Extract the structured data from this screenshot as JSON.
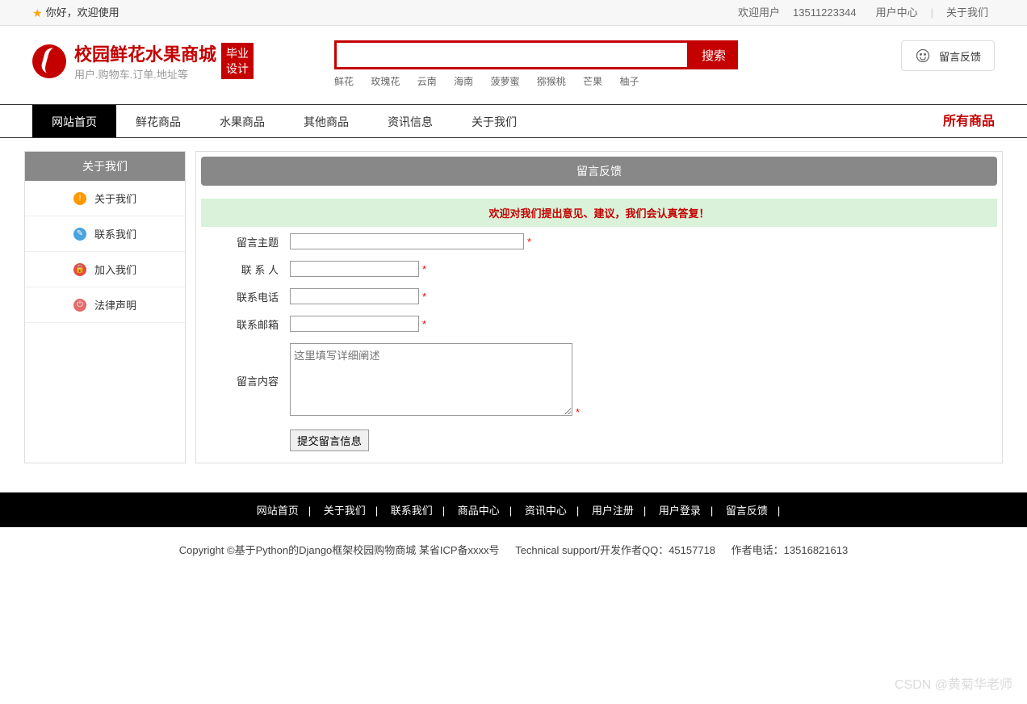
{
  "topbar": {
    "welcome": "你好，欢迎使用",
    "user_prefix": "欢迎用户",
    "phone": "13511223344",
    "user_center": "用户中心",
    "about": "关于我们"
  },
  "logo": {
    "title": "校园鲜花水果商城",
    "subtitle": "用户.购物车.订单.地址等",
    "badge": "毕业设计"
  },
  "search": {
    "button": "搜索",
    "value": "",
    "hot_words": [
      "鲜花",
      "玫瑰花",
      "云南",
      "海南",
      "菠萝蜜",
      "猕猴桃",
      "芒果",
      "柚子"
    ]
  },
  "feedback_btn": "留言反馈",
  "nav": {
    "items": [
      "网站首页",
      "鲜花商品",
      "水果商品",
      "其他商品",
      "资讯信息",
      "关于我们"
    ],
    "all": "所有商品"
  },
  "sidebar": {
    "title": "关于我们",
    "items": [
      {
        "label": "关于我们",
        "icon": "info-icon",
        "cls": "ic-orange",
        "glyph": "!"
      },
      {
        "label": "联系我们",
        "icon": "clipboard-icon",
        "cls": "ic-blue",
        "glyph": "📋"
      },
      {
        "label": "加入我们",
        "icon": "lock-icon",
        "cls": "ic-red",
        "glyph": "🔒"
      },
      {
        "label": "法律声明",
        "icon": "power-icon",
        "cls": "ic-pink",
        "glyph": "⏻"
      }
    ]
  },
  "panel": {
    "title": "留言反馈",
    "notice": "欢迎对我们提出意见、建议，我们会认真答复！",
    "fields": {
      "subject": "留言主题",
      "contact": "联 系 人",
      "phone": "联系电话",
      "email": "联系邮箱",
      "content": "留言内容",
      "placeholder": "这里填写详细阐述"
    },
    "asterisk": "*",
    "submit": "提交留言信息"
  },
  "footer": {
    "links": [
      "网站首页",
      "关于我们",
      "联系我们",
      "商品中心",
      "资讯中心",
      "用户注册",
      "用户登录",
      "留言反馈"
    ],
    "copyright": "Copyright ©基于Python的Django框架校园购物商城 某省ICP备xxxx号",
    "tech": "Technical support/开发作者QQ：45157718",
    "author_phone": "作者电话：13516821613"
  },
  "watermark": "CSDN @黄菊华老师"
}
